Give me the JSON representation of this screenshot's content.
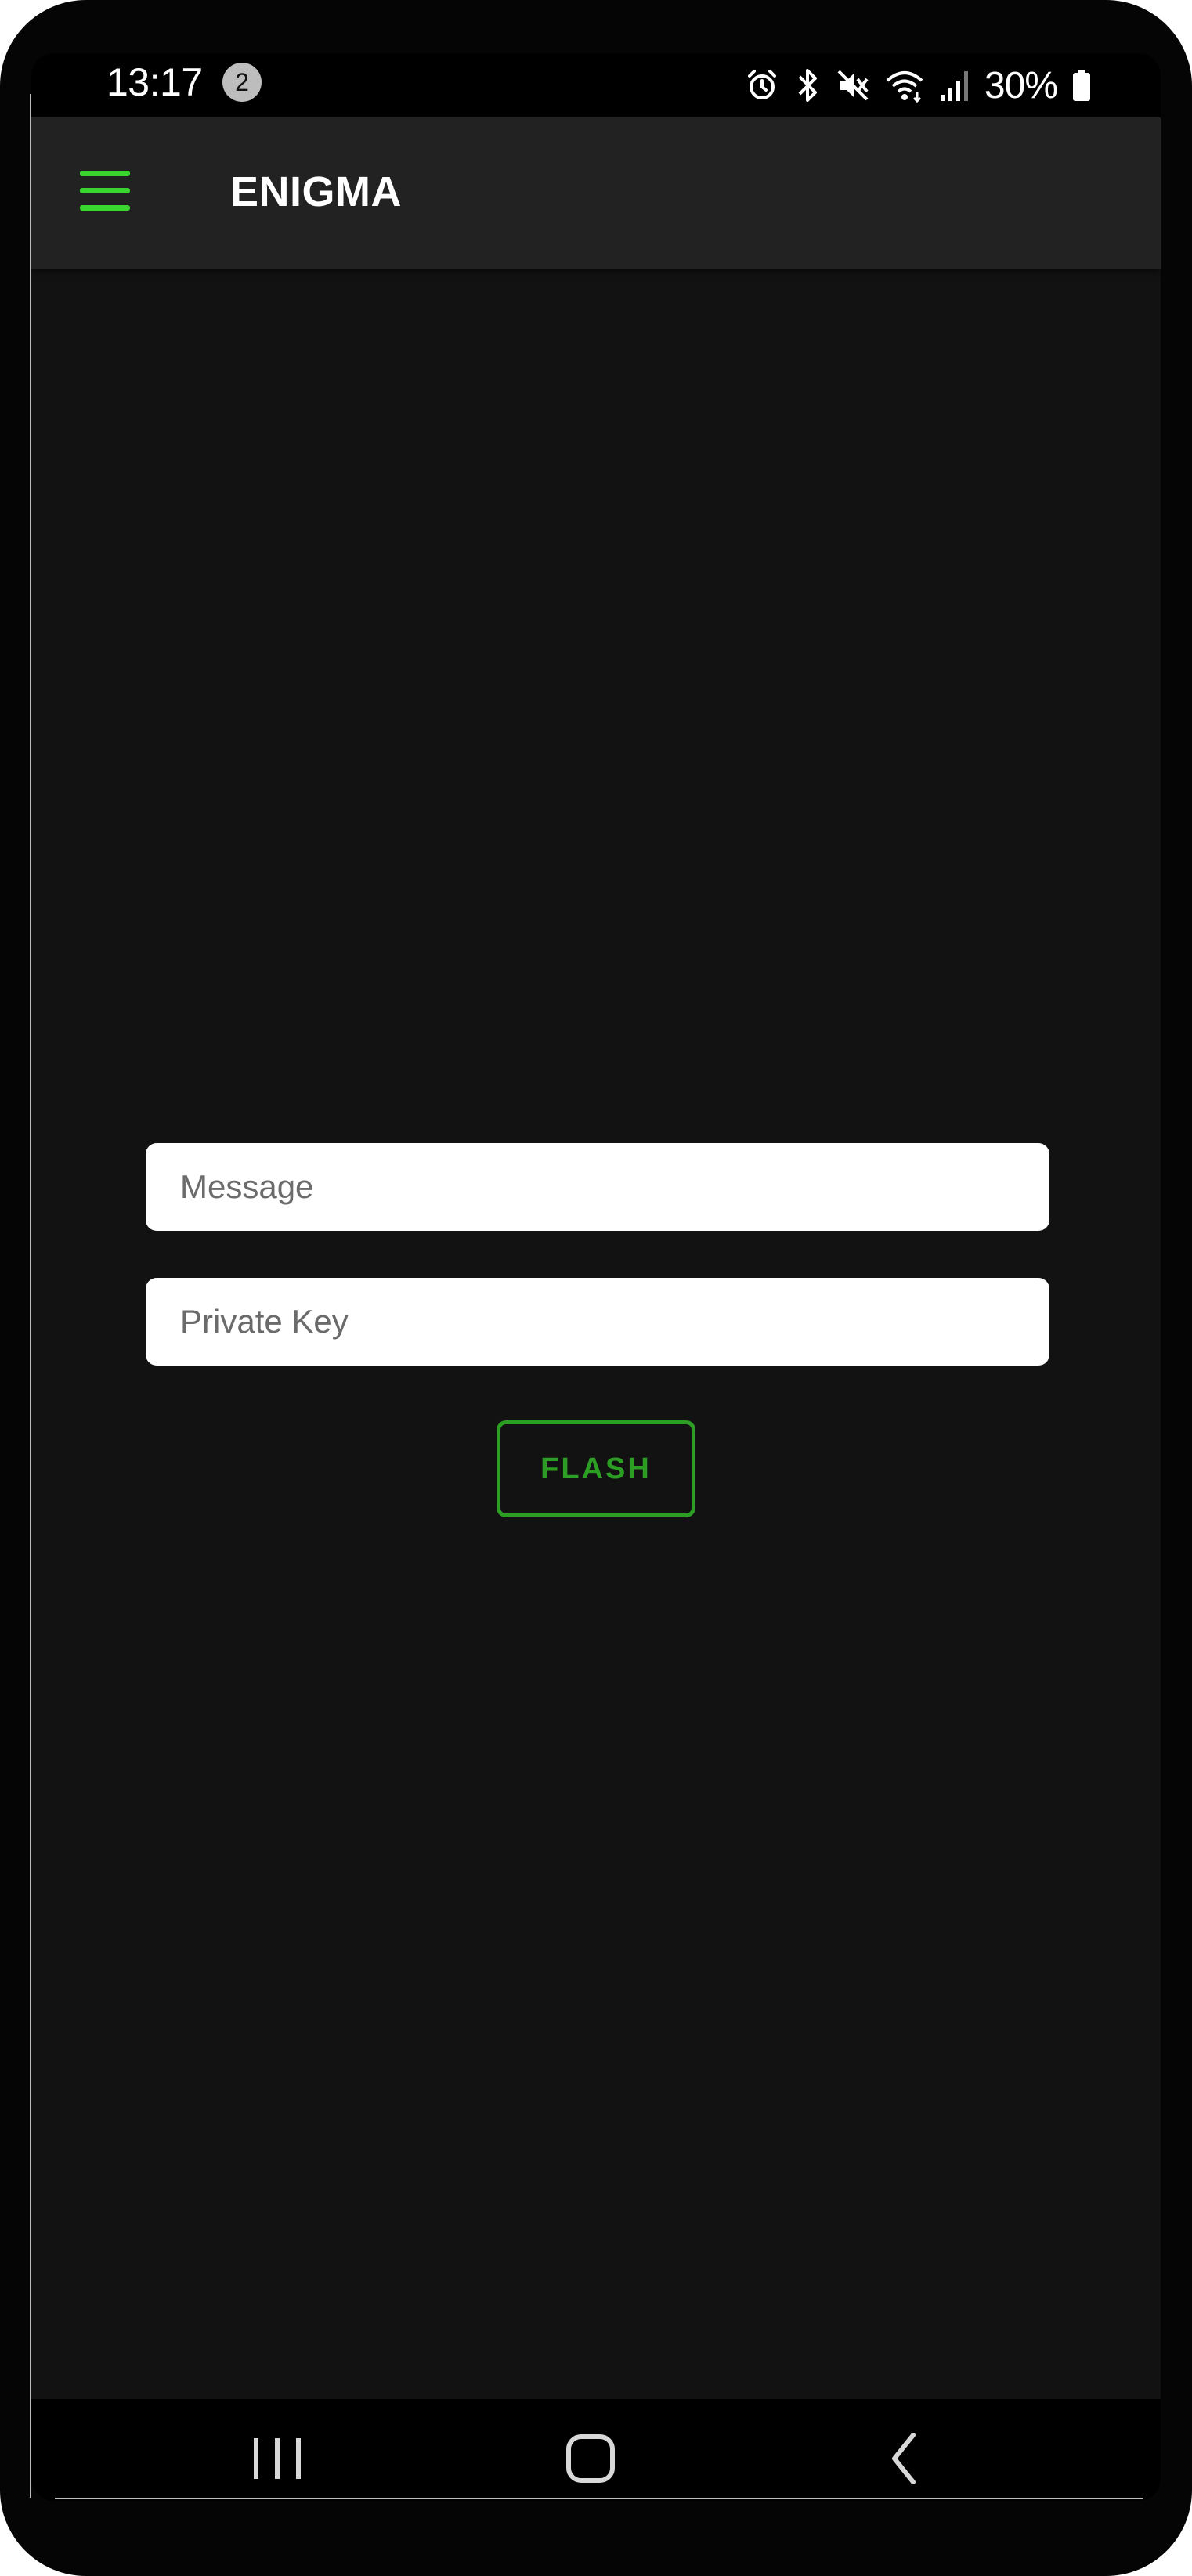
{
  "status_bar": {
    "time": "13:17",
    "notification_count": "2",
    "battery": "30%",
    "icons": [
      "alarm-icon",
      "bluetooth-icon",
      "mute-icon",
      "wifi-icon",
      "signal-icon",
      "battery-icon"
    ]
  },
  "app_bar": {
    "menu_icon": "hamburger-menu-icon",
    "title": "ENIGMA"
  },
  "form": {
    "message": {
      "placeholder": "Message",
      "value": ""
    },
    "private_key": {
      "placeholder": "Private Key",
      "value": ""
    },
    "flash_label": "FLASH"
  },
  "nav_bar": {
    "buttons": [
      "recent-apps-icon",
      "home-icon",
      "back-icon"
    ]
  },
  "colors": {
    "background": "#121212",
    "app_bar": "#222222",
    "accent_green": "#39d62f",
    "button_green": "#2c9e24",
    "field_background": "#ffffff"
  }
}
